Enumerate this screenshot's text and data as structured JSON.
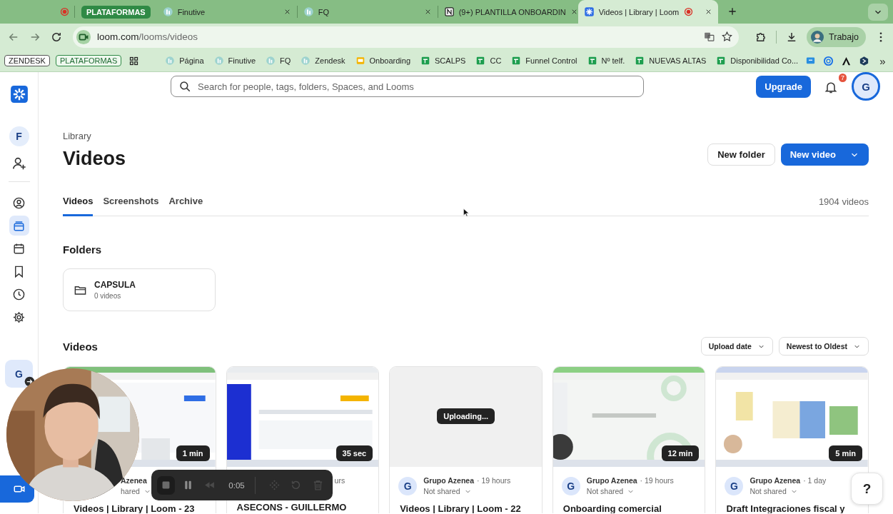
{
  "browser": {
    "tabs": [
      {
        "kind": "record",
        "selected": false
      },
      {
        "kind": "fi",
        "label": "Finutive",
        "selected": false,
        "recording": false
      },
      {
        "kind": "fi",
        "label": "FQ",
        "selected": false,
        "recording": false
      },
      {
        "kind": "notion",
        "label": "(9+) PLANTILLA ONBOARDIN",
        "selected": false,
        "recording": false
      },
      {
        "kind": "loom",
        "label": "Videos | Library | Loom",
        "selected": true,
        "recording": true
      }
    ],
    "tab_group": {
      "label": "PLATAFORMAS"
    },
    "address": {
      "host": "loom.com",
      "path": "/looms/videos"
    },
    "profile": "Trabajo",
    "bookmarks": [
      {
        "kind": "chip",
        "label": "ZENDESK"
      },
      {
        "kind": "chip-green",
        "label": "PLATAFORMAS"
      },
      {
        "kind": "apps"
      },
      {
        "kind": "fi",
        "label": "Página"
      },
      {
        "kind": "fi",
        "label": "Finutive"
      },
      {
        "kind": "fi",
        "label": "FQ"
      },
      {
        "kind": "fi",
        "label": "Zendesk"
      },
      {
        "kind": "slides",
        "label": "Onboarding"
      },
      {
        "kind": "sheets",
        "label": "SCALPS"
      },
      {
        "kind": "sheets",
        "label": "CC"
      },
      {
        "kind": "sheets",
        "label": "Funnel Control"
      },
      {
        "kind": "sheets",
        "label": "Nº telf."
      },
      {
        "kind": "sheets",
        "label": "NUEVAS ALTAS"
      },
      {
        "kind": "sheets",
        "label": "Disponibilidad Co..."
      },
      {
        "kind": "chat"
      },
      {
        "kind": "ring"
      },
      {
        "kind": "peak"
      },
      {
        "kind": "shield"
      },
      {
        "kind": "more",
        "label": "»"
      }
    ]
  },
  "sidebar": {
    "workspace": "F",
    "nav": [
      {
        "kind": "person",
        "selected": false
      },
      {
        "kind": "library",
        "selected": true
      },
      {
        "kind": "calendar",
        "selected": false
      },
      {
        "kind": "bookmark",
        "selected": false
      },
      {
        "kind": "clock",
        "selected": false
      },
      {
        "kind": "gear",
        "selected": false
      }
    ],
    "account": "G"
  },
  "header": {
    "search_placeholder": "Search for people, tags, folders, Spaces, and Looms",
    "upgrade": "Upgrade",
    "notifications": "7",
    "avatar": "G"
  },
  "library": {
    "breadcrumb": "Library",
    "title": "Videos",
    "buttons": [
      {
        "kind": "secondary",
        "label": "New folder"
      },
      {
        "kind": "primary",
        "label": "New video"
      }
    ],
    "tabs": [
      {
        "label": "Videos",
        "selected": true
      },
      {
        "label": "Screenshots",
        "selected": false
      },
      {
        "label": "Archive",
        "selected": false
      }
    ],
    "count": "1904 videos"
  },
  "folders": {
    "heading": "Folders",
    "items": [
      {
        "name": "CAPSULA",
        "count": "0 videos"
      }
    ]
  },
  "videos": {
    "heading": "Videos",
    "sorts": [
      "Upload date",
      "Newest to Oldest"
    ],
    "cards": [
      {
        "duration": "1 min",
        "author": "Azenea",
        "share": "hared",
        "title": "Videos | Library | Loom - 23"
      },
      {
        "duration": "35 sec",
        "time": "urs",
        "title": "ASECONS - GUILLERMO"
      },
      {
        "status": "Uploading...",
        "avatar": "G",
        "author": "Grupo Azenea",
        "time": "· 19 hours",
        "share": "Not shared",
        "title": "Videos | Library | Loom - 22"
      },
      {
        "duration": "12 min",
        "avatar": "G",
        "author": "Grupo Azenea",
        "time": "· 19 hours",
        "share": "Not shared",
        "title": "Onboarding comercial"
      },
      {
        "duration": "5 min",
        "avatar": "G",
        "author": "Grupo Azenea",
        "time": "· 1 day",
        "share": "Not shared",
        "title": "Draft Integraciones fiscal y"
      }
    ]
  },
  "recorder": {
    "time": "0:05",
    "controls": [
      {
        "kind": "stop",
        "disabled": false
      },
      {
        "kind": "pause",
        "disabled": false
      },
      {
        "kind": "rewind",
        "disabled": true
      },
      {
        "kind": "draw",
        "disabled": true
      },
      {
        "kind": "restart",
        "disabled": true
      },
      {
        "kind": "delete",
        "disabled": true
      }
    ]
  },
  "help": "?"
}
